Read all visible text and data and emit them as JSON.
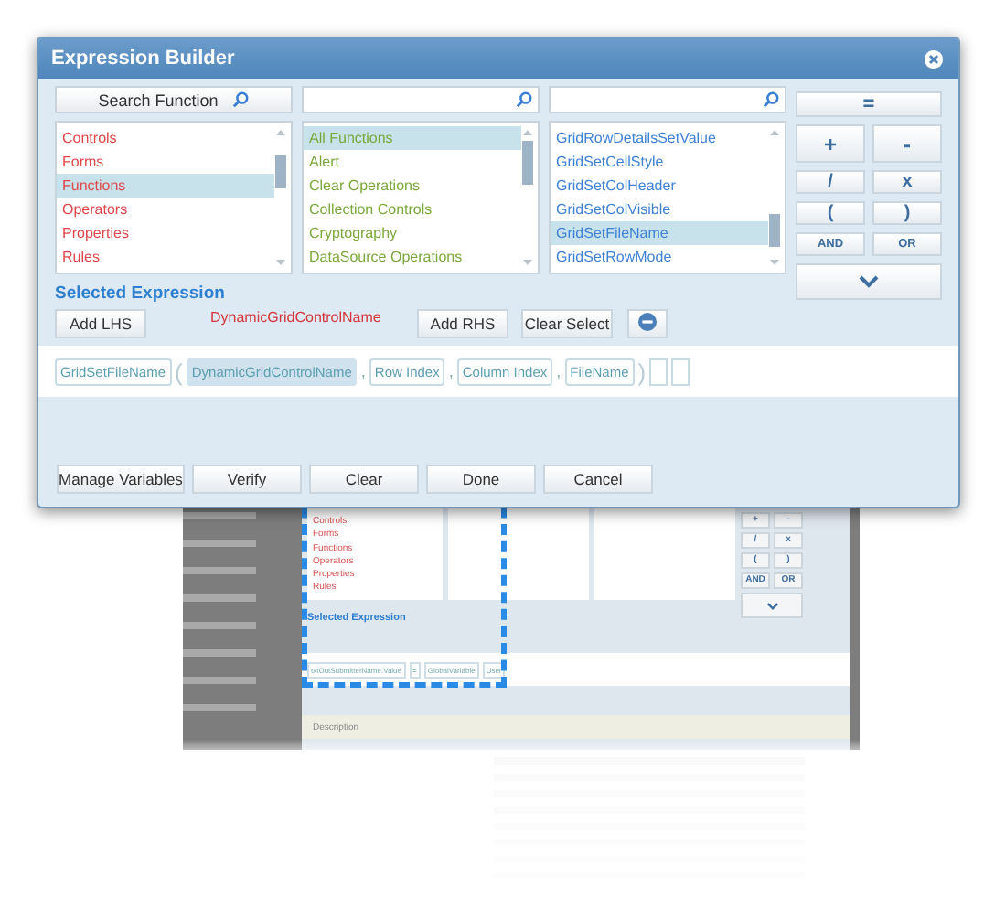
{
  "dialog": {
    "title": "Expression Builder",
    "search": [
      {
        "kind": "button",
        "label": "Search Function"
      },
      {
        "kind": "field"
      },
      {
        "kind": "field"
      }
    ],
    "lists": [
      {
        "kind": "category",
        "items": [
          {
            "label": "Controls",
            "selected": false
          },
          {
            "label": "Forms",
            "selected": false
          },
          {
            "label": "Functions",
            "selected": true
          },
          {
            "label": "Operators",
            "selected": false
          },
          {
            "label": "Properties",
            "selected": false
          },
          {
            "label": "Rules",
            "selected": false
          }
        ]
      },
      {
        "kind": "group",
        "items": [
          {
            "label": "All Functions",
            "selected": true
          },
          {
            "label": "Alert",
            "selected": false
          },
          {
            "label": "Clear Operations",
            "selected": false
          },
          {
            "label": "Collection Controls",
            "selected": false
          },
          {
            "label": "Cryptography",
            "selected": false
          },
          {
            "label": "DataSource Operations",
            "selected": false
          }
        ]
      },
      {
        "kind": "function",
        "items": [
          {
            "label": "GridRowDetailsSetValue",
            "selected": false
          },
          {
            "label": "GridSetCellStyle",
            "selected": false
          },
          {
            "label": "GridSetColHeader",
            "selected": false
          },
          {
            "label": "GridSetColVisible",
            "selected": false
          },
          {
            "label": "GridSetFileName",
            "selected": true
          },
          {
            "label": "GridSetRowMode",
            "selected": false
          }
        ]
      }
    ],
    "operators": [
      {
        "kind": "wide",
        "label": "="
      },
      {
        "kind": "large",
        "label": "+"
      },
      {
        "kind": "large",
        "label": "-"
      },
      {
        "kind": "small",
        "label": "/"
      },
      {
        "kind": "small",
        "label": "x"
      },
      {
        "kind": "small",
        "label": "("
      },
      {
        "kind": "small",
        "label": ")"
      },
      {
        "kind": "word",
        "label": "AND"
      },
      {
        "kind": "word",
        "label": "OR"
      },
      {
        "kind": "expand"
      }
    ],
    "selected_expression": {
      "heading": "Selected Expression",
      "current_name": "DynamicGridControlName",
      "buttons": [
        "Add LHS",
        "Add RHS",
        "Clear Select"
      ]
    },
    "tokens": [
      {
        "kind": "token",
        "text": "GridSetFileName",
        "selected": false
      },
      {
        "kind": "separator",
        "text": "("
      },
      {
        "kind": "token",
        "text": "DynamicGridControlName",
        "selected": true
      },
      {
        "kind": "separator",
        "text": ","
      },
      {
        "kind": "token",
        "text": "Row Index",
        "selected": false
      },
      {
        "kind": "separator",
        "text": ","
      },
      {
        "kind": "token",
        "text": "Column Index",
        "selected": false
      },
      {
        "kind": "separator",
        "text": ","
      },
      {
        "kind": "token",
        "text": "FileName",
        "selected": false
      },
      {
        "kind": "separator",
        "text": ")"
      },
      {
        "kind": "empty"
      },
      {
        "kind": "empty"
      }
    ],
    "actions": [
      "Manage Variables",
      "Verify",
      "Clear",
      "Done",
      "Cancel"
    ]
  },
  "background": {
    "categories": [
      "Controls",
      "Forms",
      "Functions",
      "Operators",
      "Properties",
      "Rules"
    ],
    "operators": [
      "+",
      "-",
      "/",
      "x",
      "(",
      ")",
      "AND",
      "OR"
    ],
    "heading": "Selected Expression",
    "tokens": [
      "txtOutSubmitterName.Value",
      "=",
      "GlobalVariable",
      "User"
    ],
    "description": "Description"
  }
}
